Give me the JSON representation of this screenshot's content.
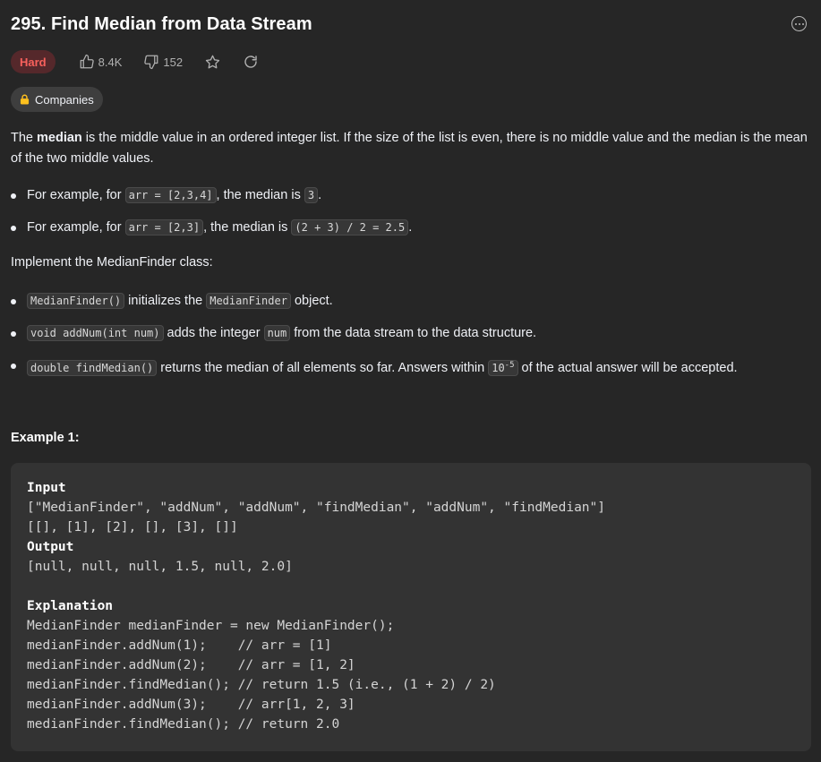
{
  "problem": {
    "title": "295. Find Median from Data Stream",
    "difficulty": "Hard",
    "likes": "8.4K",
    "dislikes": "152",
    "companies_label": "Companies"
  },
  "description": {
    "intro_a": "The ",
    "intro_bold": "median",
    "intro_b": " is the middle value in an ordered integer list. If the size of the list is even, there is no middle value and the median is the mean of the two middle values.",
    "bullet1": {
      "a": "For example, for ",
      "code1": "arr = [2,3,4]",
      "b": ", the median is ",
      "code2": "3",
      "c": "."
    },
    "bullet2": {
      "a": "For example, for ",
      "code1": "arr = [2,3]",
      "b": ", the median is ",
      "code2": "(2 + 3) / 2 = 2.5",
      "c": "."
    },
    "implement": "Implement the MedianFinder class:",
    "method1": {
      "code1": "MedianFinder()",
      "a": " initializes the ",
      "code2": "MedianFinder",
      "b": " object."
    },
    "method2": {
      "code1": "void addNum(int num)",
      "a": " adds the integer ",
      "code2": "num",
      "b": " from the data stream to the data structure."
    },
    "method3": {
      "code1": "double findMedian()",
      "a": " returns the median of all elements so far. Answers within ",
      "code_base": "10",
      "code_sup": "-5",
      "b": " of the actual answer will be accepted."
    }
  },
  "example": {
    "title": "Example 1:",
    "input_label": "Input",
    "input_line1": "[\"MedianFinder\", \"addNum\", \"addNum\", \"findMedian\", \"addNum\", \"findMedian\"]",
    "input_line2": "[[], [1], [2], [], [3], []]",
    "output_label": "Output",
    "output_line": "[null, null, null, 1.5, null, 2.0]",
    "explanation_label": "Explanation",
    "explanation_lines": [
      "MedianFinder medianFinder = new MedianFinder();",
      "medianFinder.addNum(1);    // arr = [1]",
      "medianFinder.addNum(2);    // arr = [1, 2]",
      "medianFinder.findMedian(); // return 1.5 (i.e., (1 + 2) / 2)",
      "medianFinder.addNum(3);    // arr[1, 2, 3]",
      "medianFinder.findMedian(); // return 2.0"
    ]
  },
  "colors": {
    "background": "#262626",
    "hard": "#f8615c",
    "hard_bg": "#55282b",
    "code_bg": "#333333"
  },
  "icons": [
    "more-icon",
    "thumbs-up-icon",
    "thumbs-down-icon",
    "star-icon",
    "share-icon",
    "lock-icon"
  ]
}
